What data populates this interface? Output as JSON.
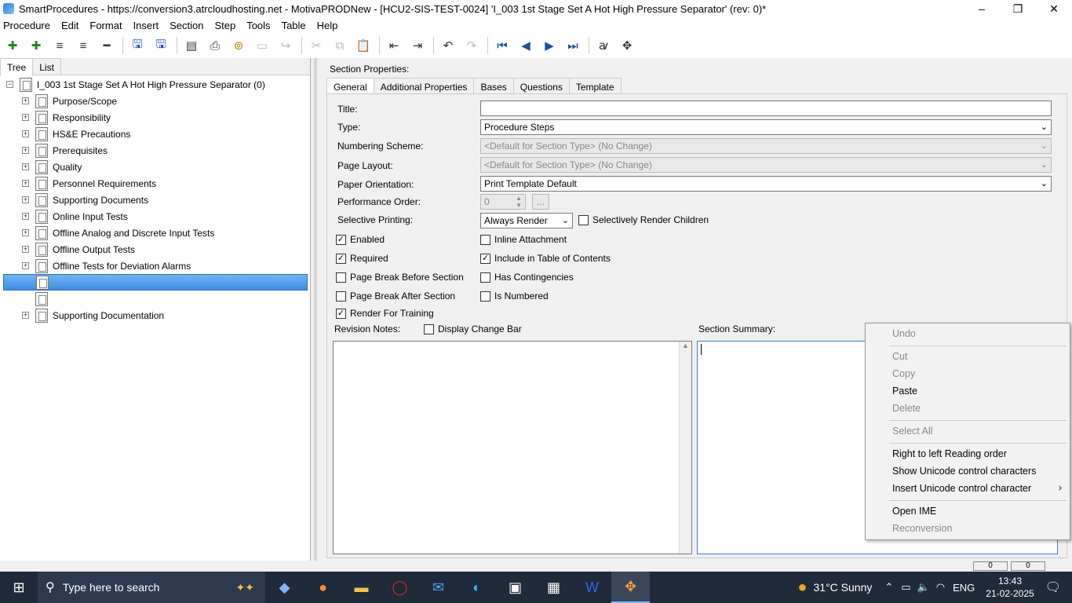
{
  "window": {
    "title": "SmartProcedures - https://conversion3.atrcloudhosting.net - MotivaPRODNew - [HCU2-SIS-TEST-0024] 'I_003 1st Stage Set A Hot High Pressure Separator' (rev: 0)*",
    "minimize": "–",
    "restore": "❐",
    "close": "✕"
  },
  "menu": [
    "Procedure",
    "Edit",
    "Format",
    "Insert",
    "Section",
    "Step",
    "Tools",
    "Table",
    "Help"
  ],
  "toolbar": {
    "icons": [
      "add-icon",
      "add-child-icon",
      "list-icon",
      "list-indent-icon",
      "remove-icon",
      "save-all-icon",
      "save-icon",
      "print-preview-icon",
      "print-icon",
      "link-icon",
      "image-icon",
      "redo-arrow-icon",
      "cut-icon",
      "copy-icon",
      "paste-icon",
      "outdent-icon",
      "indent-icon",
      "undo-icon",
      "redo-icon",
      "first-icon",
      "previous-icon",
      "next-icon",
      "last-icon",
      "spell-icon",
      "move-icon"
    ],
    "glyphs": [
      "✚",
      "✚",
      "≡",
      "≡",
      "━",
      "🖫",
      "🖫",
      "▤",
      "⎙",
      "⊚",
      "▭",
      "↪",
      "✂",
      "⧉",
      "📋",
      "⇤",
      "⇥",
      "↶",
      "↷",
      "⏮",
      "◀",
      "▶",
      "⏭",
      "ꜹ",
      "✥"
    ]
  },
  "left_tabs": [
    "Tree",
    "List"
  ],
  "tree": {
    "root": "I_003 1st Stage Set A Hot High Pressure Separator (0)",
    "items": [
      "Purpose/Scope",
      "Responsibility",
      "HS&E Precautions",
      "Prerequisites",
      "Quality",
      "Personnel Requirements",
      "Supporting Documents",
      "Online Input Tests",
      "Offline Analog and Discrete Input Tests",
      "Offline Output Tests",
      "Offline Tests for Deviation Alarms",
      "",
      "",
      "Supporting Documentation"
    ]
  },
  "section": {
    "heading": "Section Properties:",
    "tabs": [
      "General",
      "Additional Properties",
      "Bases",
      "Questions",
      "Template"
    ],
    "labels": {
      "title": "Title:",
      "type": "Type:",
      "numbering": "Numbering Scheme:",
      "layout": "Page Layout:",
      "orientation": "Paper Orientation:",
      "perf_order": "Performance Order:",
      "selective": "Selective Printing:",
      "revision_notes": "Revision Notes:",
      "summary": "Section Summary:"
    },
    "values": {
      "title": "",
      "type": "Procedure Steps",
      "numbering": "<Default for Section Type> (No Change)",
      "layout": "<Default for Section Type> (No Change)",
      "orientation": "Print Template Default",
      "perf_order": "0",
      "perf_btn": "...",
      "selective": "Always Render"
    },
    "checkboxes": {
      "selectively_render_children": {
        "label": "Selectively Render Children",
        "checked": false
      },
      "enabled": {
        "label": "Enabled",
        "checked": true
      },
      "inline_attachment": {
        "label": "Inline Attachment",
        "checked": false
      },
      "required": {
        "label": "Required",
        "checked": true
      },
      "include_toc": {
        "label": "Include in Table of Contents",
        "checked": true
      },
      "page_break_before": {
        "label": "Page Break Before Section",
        "checked": false
      },
      "has_contingencies": {
        "label": "Has Contingencies",
        "checked": false
      },
      "page_break_after": {
        "label": "Page Break After Section",
        "checked": false
      },
      "is_numbered": {
        "label": "Is Numbered",
        "checked": false
      },
      "render_training": {
        "label": "Render For Training",
        "checked": true
      },
      "display_change_bar": {
        "label": "Display Change Bar",
        "checked": false
      }
    }
  },
  "context_menu": [
    {
      "label": "Undo",
      "enabled": false
    },
    {
      "label": "Cut",
      "enabled": false
    },
    {
      "label": "Copy",
      "enabled": false
    },
    {
      "label": "Paste",
      "enabled": true
    },
    {
      "label": "Delete",
      "enabled": false
    },
    {
      "label": "Select All",
      "enabled": false
    },
    {
      "label": "Right to left Reading order",
      "enabled": true
    },
    {
      "label": "Show Unicode control characters",
      "enabled": true
    },
    {
      "label": "Insert Unicode control character",
      "enabled": true,
      "submenu": true
    },
    {
      "label": "Open IME",
      "enabled": true
    },
    {
      "label": "Reconversion",
      "enabled": false
    }
  ],
  "status": {
    "left": "0",
    "right": "0"
  },
  "taskbar": {
    "search_placeholder": "Type here to search",
    "weather": "31°C  Sunny",
    "lang": "ENG",
    "time": "13:43",
    "date": "21-02-2025"
  }
}
